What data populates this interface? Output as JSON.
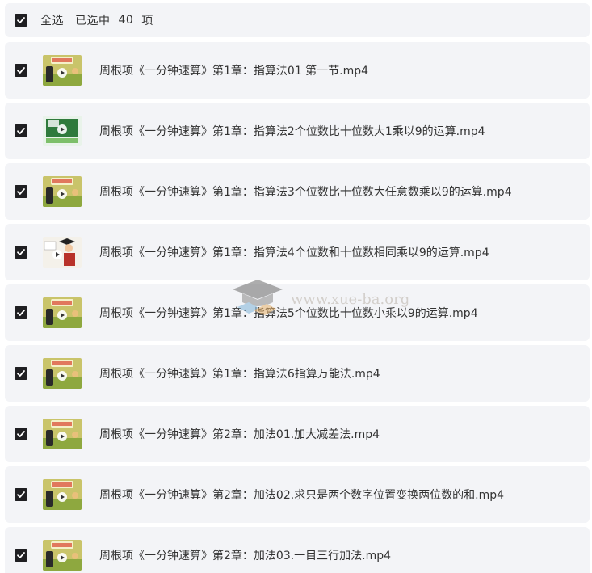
{
  "header": {
    "select_all_label": "全选",
    "selected_prefix": "已选中",
    "selected_count": "40",
    "selected_suffix": "项",
    "checked": true
  },
  "files": [
    {
      "name": "周根项《一分钟速算》第1章：指算法01 第一节.mp4",
      "thumb": "cartoon",
      "checked": true
    },
    {
      "name": "周根项《一分钟速算》第1章：指算法2个位数比十位数大1乘以9的运算.mp4",
      "thumb": "classroom",
      "checked": true
    },
    {
      "name": "周根项《一分钟速算》第1章：指算法3个位数比十位数大任意数乘以9的运算.mp4",
      "thumb": "cartoon",
      "checked": true
    },
    {
      "name": "周根项《一分钟速算》第1章：指算法4个位数和十位数相同乘以9的运算.mp4",
      "thumb": "teacher",
      "checked": true
    },
    {
      "name": "周根项《一分钟速算》第1章：指算法5个位数比十位数小乘以9的运算.mp4",
      "thumb": "cartoon",
      "checked": true
    },
    {
      "name": "周根项《一分钟速算》第1章：指算法6指算万能法.mp4",
      "thumb": "cartoon",
      "checked": true
    },
    {
      "name": "周根项《一分钟速算》第2章：加法01.加大减差法.mp4",
      "thumb": "cartoon",
      "checked": true
    },
    {
      "name": "周根项《一分钟速算》第2章：加法02.求只是两个数字位置变换两位数的和.mp4",
      "thumb": "cartoon",
      "checked": true
    },
    {
      "name": "周根项《一分钟速算》第2章：加法03.一目三行加法.mp4",
      "thumb": "cartoon",
      "checked": true
    }
  ],
  "watermark": {
    "text": "www.xue-ba.org"
  },
  "colors": {
    "row_bg": "#f3f4f7",
    "checkbox": "#1f1f22",
    "text": "#333333"
  }
}
